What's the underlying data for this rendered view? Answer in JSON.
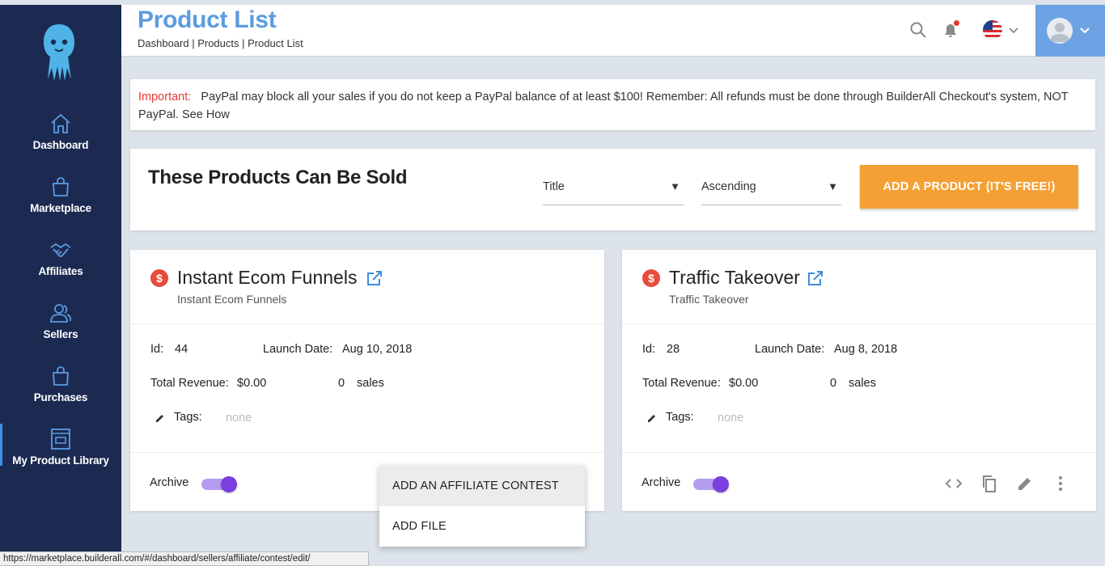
{
  "sidebar": {
    "items": [
      {
        "label": "Dashboard",
        "icon": "home-icon"
      },
      {
        "label": "Marketplace",
        "icon": "shopping-bag-icon"
      },
      {
        "label": "Affiliates",
        "icon": "handshake-icon"
      },
      {
        "label": "Sellers",
        "icon": "users-icon"
      },
      {
        "label": "Purchases",
        "icon": "shopping-bag-icon"
      },
      {
        "label": "My Product Library",
        "icon": "library-icon",
        "active": true
      }
    ]
  },
  "header": {
    "title": "Product List",
    "breadcrumb": "Dashboard | Products | Product List",
    "icons": [
      "search-icon",
      "bell-icon",
      "us-flag-icon",
      "avatar"
    ]
  },
  "notice": {
    "label": "Important:",
    "text": "PayPal may block all your sales if you do not keep a PayPal balance of at least $100! Remember: All refunds must be done through BuilderAll Checkout's system, NOT PayPal. See How"
  },
  "toolbar": {
    "heading": "These Products Can Be Sold",
    "sort_field": "Title",
    "sort_order": "Ascending",
    "add_button": "ADD A PRODUCT (IT'S FREE!)"
  },
  "labels": {
    "id": "Id:",
    "launch_date": "Launch Date:",
    "total_revenue": "Total Revenue:",
    "sales": "sales",
    "tags": "Tags:",
    "archive": "Archive"
  },
  "products": [
    {
      "title": "Instant Ecom Funnels",
      "subtitle": "Instant Ecom Funnels",
      "id": "44",
      "launch_date": "Aug 10, 2018",
      "revenue": "$0.00",
      "sales_count": "0",
      "tags": "none",
      "archived": true
    },
    {
      "title": "Traffic Takeover",
      "subtitle": "Traffic Takeover",
      "id": "28",
      "launch_date": "Aug 8, 2018",
      "revenue": "$0.00",
      "sales_count": "0",
      "tags": "none",
      "archived": true
    }
  ],
  "menu": {
    "items": [
      "ADD AN AFFILIATE CONTEST",
      "ADD FILE"
    ]
  },
  "status_bar": {
    "url": "https://marketplace.builderall.com/#/dashboard/sellers/affiliate/contest/edit/"
  },
  "colors": {
    "sidebar": "#1c2a52",
    "accent": "#5b9be0",
    "button": "#f5a034",
    "important": "#e53935",
    "toggle": "#7b3fe0"
  }
}
